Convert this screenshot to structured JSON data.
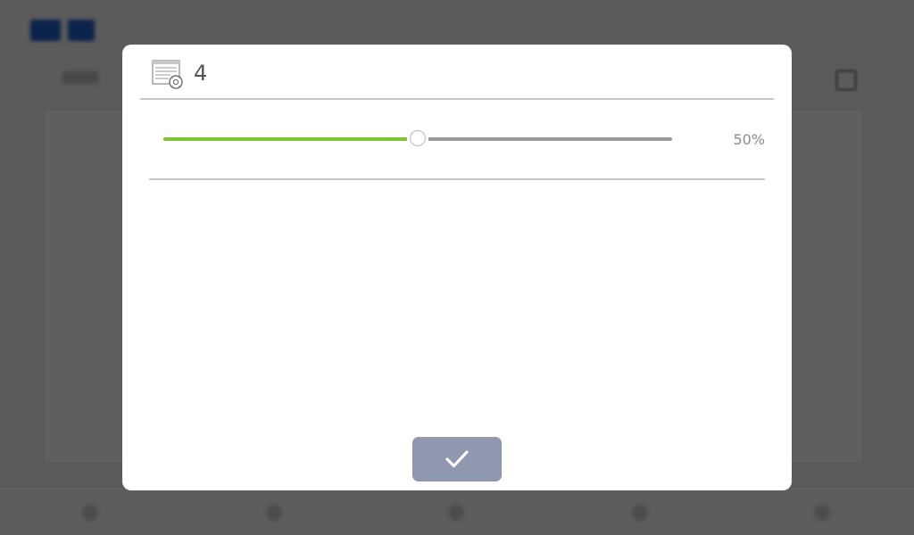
{
  "dialog": {
    "title": "4",
    "header_icon": "display-settings-icon",
    "confirm_icon": "checkmark-icon"
  },
  "slider": {
    "value_label": "50%",
    "value": 0.5
  },
  "colors": {
    "slider_fill": "#80c531",
    "slider_track": "#9a9a9a",
    "confirm_button": "#8f97b1",
    "overlay": "rgba(0,0,0,0.62)"
  }
}
